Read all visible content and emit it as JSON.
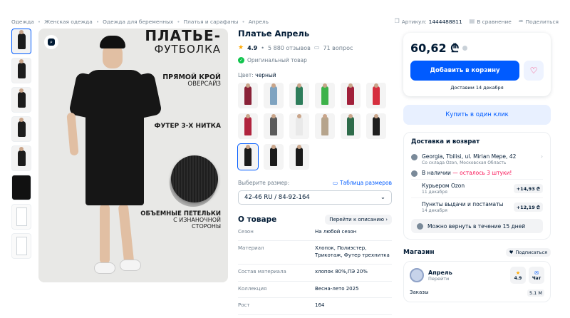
{
  "breadcrumbs": [
    "Одежда",
    "Женская одежда",
    "Одежда для беременных",
    "Платья и сарафаны",
    "Апрель"
  ],
  "header_actions": {
    "article_label": "Артикул:",
    "article_code": "1444488811",
    "compare": "В сравнение",
    "share": "Поделиться"
  },
  "gallery": {
    "promo_title_line1": "ПЛАТЬЕ-",
    "promo_title_line2": "ФУТБОЛКА",
    "promo_cut": "ПРЯМОЙ КРОЙ",
    "promo_fit": "ОВЕРСАЙЗ",
    "promo_fabric": "ФУТЕР 3-Х НИТКА",
    "promo_loops_1": "ОБЪЕМНЫЕ ПЕТЕЛЬКИ",
    "promo_loops_2": "С ИЗНАНОЧНОЙ",
    "promo_loops_3": "СТОРОНЫ"
  },
  "product": {
    "title": "Платье Апрель",
    "rating": "4.9",
    "reviews": "5 880 отзывов",
    "questions": "71 вопрос",
    "original": "Оригинальный товар",
    "color_label": "Цвет:",
    "color_value": "черный",
    "swatch_colors": [
      "#8a2238",
      "#7fa3c0",
      "#2e7d5b",
      "#3db24a",
      "#a1203a",
      "#d62f3f",
      "#b0243e",
      "#5b5b5b",
      "#e9e9e9",
      "#b6a48c",
      "#2e6b4a",
      "#1f1f1f",
      "#1a1a1a",
      "#1a1a1a",
      "#1a1a1a"
    ],
    "size_label": "Выберите размер:",
    "size_table": "Таблица размеров",
    "size_value": "42-46 RU / 84-92-164"
  },
  "about": {
    "title": "О товаре",
    "goto": "Перейти к описанию",
    "specs": [
      {
        "k": "Сезон",
        "v": "На любой сезон"
      },
      {
        "k": "Материал",
        "v": "Хлопок, Полиэстер, Трикотаж, Футер трехнитка"
      },
      {
        "k": "Состав материала",
        "v": "хлопок 80%,ПЭ 20%"
      },
      {
        "k": "Коллекция",
        "v": "Весна-лето 2025"
      },
      {
        "k": "Рост",
        "v": "164"
      }
    ]
  },
  "buy": {
    "price": "60,62 ₾",
    "cart": "Добавить в корзину",
    "delivery_date": "Доставим 14 декабря",
    "one_click": "Купить в один клик"
  },
  "delivery": {
    "title": "Доставка и возврат",
    "address": "Georgia, Tbilisi, ul. Mirian Mepe, 42",
    "address_sub": "Со склада Ozon, Московская Область",
    "stock": "В наличии",
    "stock_warn": " — осталось 3 штуки!",
    "options": [
      {
        "name": "Курьером Ozon",
        "date": "11 декабря",
        "price": "+14,93 ₾"
      },
      {
        "name": "Пункты выдачи и постаматы",
        "date": "14 декабря",
        "price": "+12,19 ₾"
      }
    ],
    "returns": "Можно вернуть в течение 15 дней"
  },
  "shop": {
    "title": "Магазин",
    "subscribe": "Подписаться",
    "name": "Апрель",
    "go": "Перейти",
    "rating": "4.9",
    "chat": "Чат",
    "orders_label": "Заказы",
    "orders_count": "5.1 М"
  }
}
